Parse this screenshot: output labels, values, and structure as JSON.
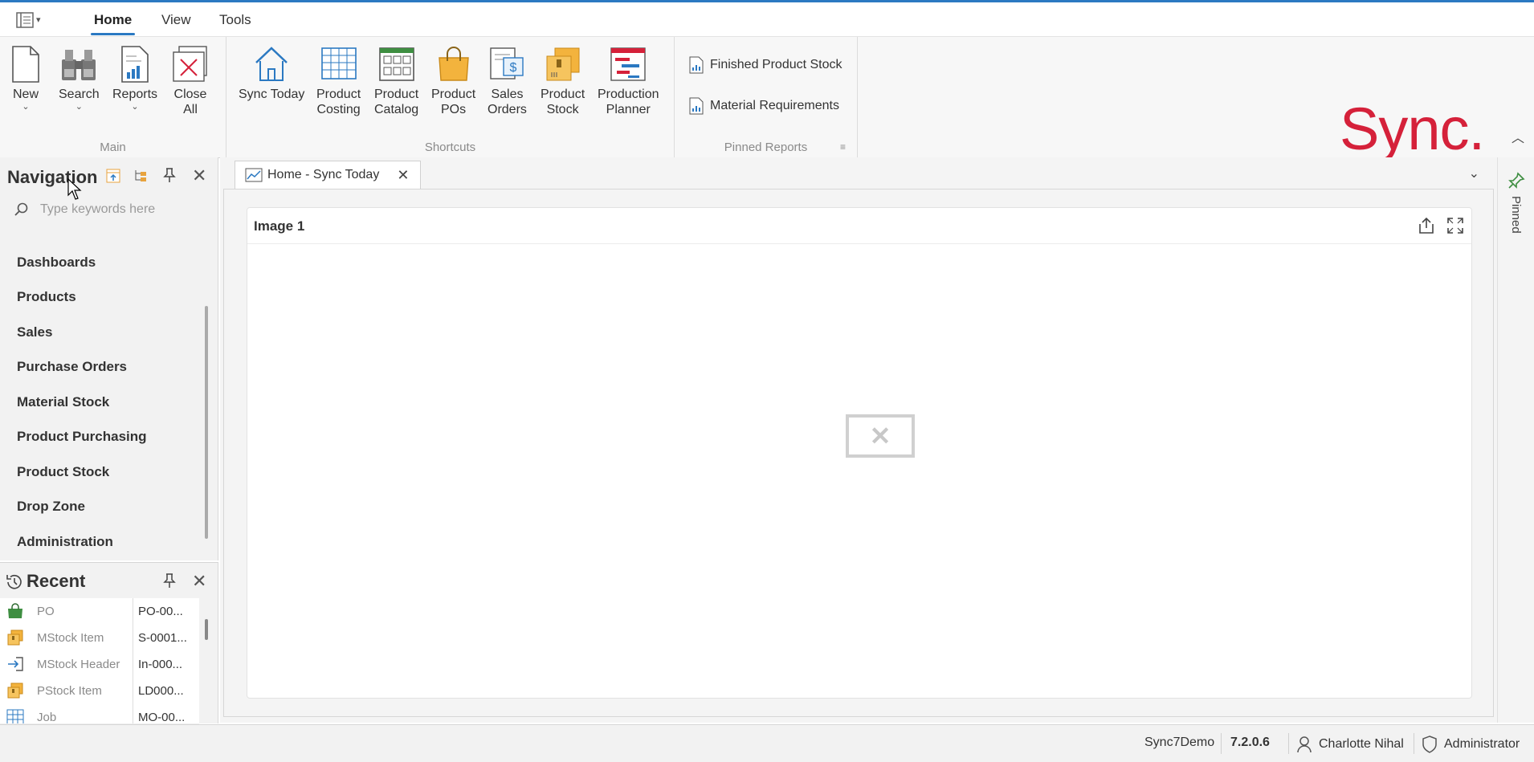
{
  "menu": {
    "tabs": [
      "Home",
      "View",
      "Tools"
    ]
  },
  "ribbon": {
    "groups": {
      "main": "Main",
      "shortcuts": "Shortcuts",
      "pinned_reports": "Pinned Reports"
    },
    "main_buttons": [
      {
        "line1": "New",
        "line2": ""
      },
      {
        "line1": "Search",
        "line2": ""
      },
      {
        "line1": "Reports",
        "line2": ""
      },
      {
        "line1": "Close",
        "line2": "All"
      }
    ],
    "shortcut_buttons": [
      {
        "line1": "Sync Today",
        "line2": ""
      },
      {
        "line1": "Product",
        "line2": "Costing"
      },
      {
        "line1": "Product",
        "line2": "Catalog"
      },
      {
        "line1": "Product",
        "line2": "POs"
      },
      {
        "line1": "Sales",
        "line2": "Orders"
      },
      {
        "line1": "Product",
        "line2": "Stock"
      },
      {
        "line1": "Production",
        "line2": "Planner"
      }
    ],
    "pinned_reports": [
      "Finished Product Stock",
      "Material Requirements"
    ],
    "logo_text": "Sync.",
    "brand_color": "#d5213a"
  },
  "navigation": {
    "title": "Navigation",
    "search_placeholder": "Type keywords here",
    "items": [
      "Dashboards",
      "Products",
      "Sales",
      "Purchase Orders",
      "Material Stock",
      "Product Purchasing",
      "Product Stock",
      "Drop Zone",
      "Administration"
    ]
  },
  "recent": {
    "title": "Recent",
    "rows": [
      {
        "type": "PO",
        "value": "PO-00...",
        "icon": "bag-icon"
      },
      {
        "type": "MStock Item",
        "value": "S-0001...",
        "icon": "stock-box-icon"
      },
      {
        "type": "MStock Header",
        "value": "In-000...",
        "icon": "arrow-in-icon"
      },
      {
        "type": "PStock Item",
        "value": "LD000...",
        "icon": "stock-box-icon"
      },
      {
        "type": "Job",
        "value": "MO-00...",
        "icon": "grid-icon"
      }
    ]
  },
  "document": {
    "tab_label": "Home - Sync Today",
    "card_title": "Image 1"
  },
  "pinned_strip": {
    "label": "Pinned"
  },
  "status": {
    "database": "Sync7Demo",
    "version": "7.2.0.6",
    "user": "Charlotte Nihal",
    "role": "Administrator"
  },
  "colors": {
    "accent": "#2b79c2"
  }
}
